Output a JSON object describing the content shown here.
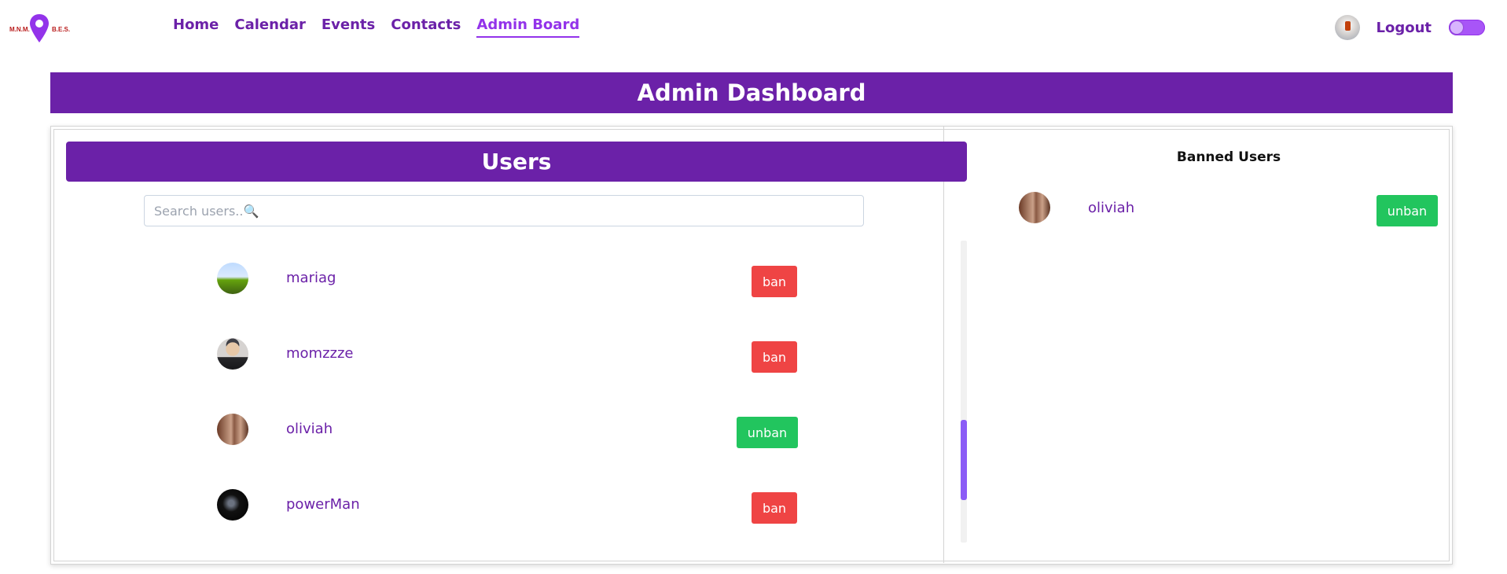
{
  "nav": {
    "logo_alt": "logo",
    "links": [
      {
        "label": "Home",
        "active": false
      },
      {
        "label": "Calendar",
        "active": false
      },
      {
        "label": "Events",
        "active": false
      },
      {
        "label": "Contacts",
        "active": false
      },
      {
        "label": "Admin Board",
        "active": true
      }
    ],
    "logout_label": "Logout",
    "theme_toggle": "off"
  },
  "dashboard": {
    "title": "Admin Dashboard"
  },
  "users": {
    "title": "Users",
    "search_placeholder": "Search users..🔍",
    "list": [
      {
        "username": "mariag",
        "action": "ban",
        "avatar": "landscape-avatar"
      },
      {
        "username": "momzzze",
        "action": "ban",
        "avatar": "man-avatar"
      },
      {
        "username": "oliviah",
        "action": "unban",
        "avatar": "face-avatar"
      },
      {
        "username": "powerMan",
        "action": "ban",
        "avatar": "dark-avatar"
      }
    ]
  },
  "banned": {
    "title": "Banned Users",
    "list": [
      {
        "username": "oliviah",
        "action": "unban",
        "avatar": "face-avatar"
      }
    ]
  },
  "colors": {
    "brand_purple": "#6b21a8",
    "ban_red": "#ef4444",
    "unban_green": "#22c55e",
    "scroll_thumb": "#8b5cf6"
  }
}
